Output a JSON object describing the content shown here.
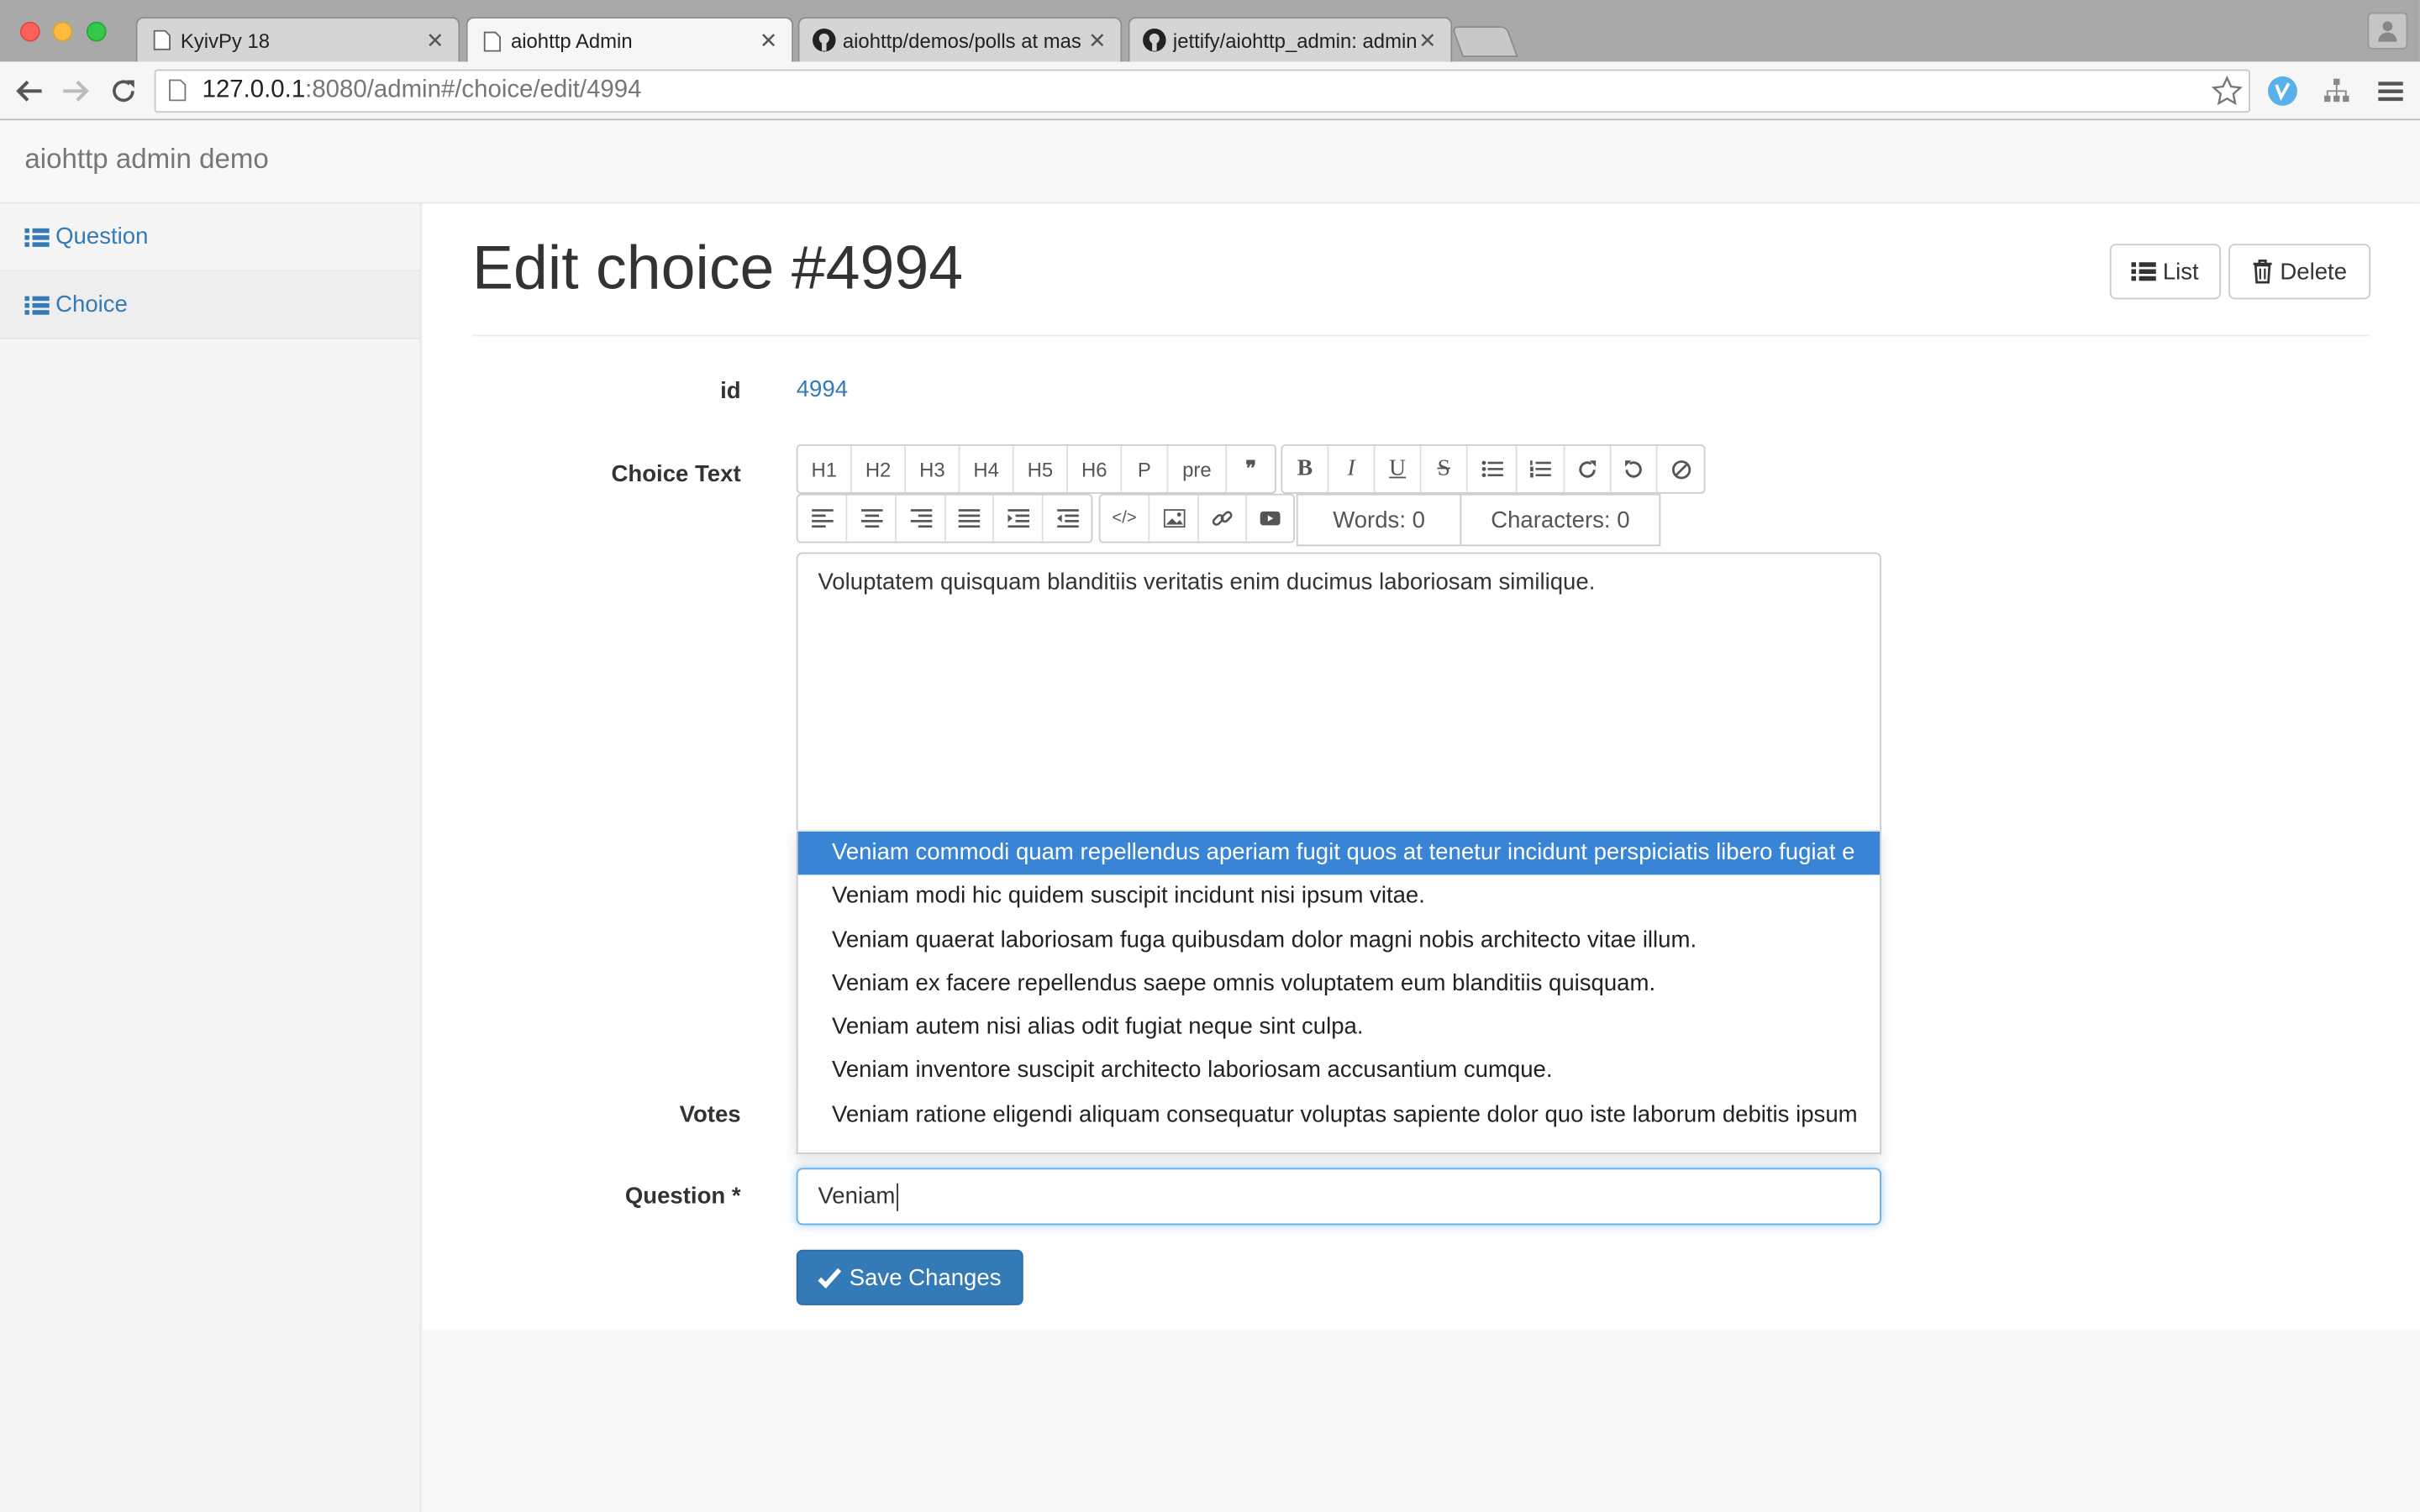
{
  "browser": {
    "tabs": [
      {
        "title": "KyivPy 18",
        "icon": "page-icon"
      },
      {
        "title": "aiohttp Admin",
        "icon": "page-icon"
      },
      {
        "title": "aiohttp/demos/polls at mas",
        "icon": "github-icon"
      },
      {
        "title": "jettify/aiohttp_admin: admin",
        "icon": "github-icon"
      }
    ],
    "url_host": "127.0.0.1",
    "url_path": ":8080/admin#/choice/edit/4994"
  },
  "app": {
    "brand": "aiohttp admin demo",
    "sidebar": [
      {
        "label": "Question"
      },
      {
        "label": "Choice"
      }
    ],
    "page_title": "Edit choice #4994",
    "buttons": {
      "list": "List",
      "delete": "Delete",
      "save": "Save Changes"
    },
    "fields": {
      "id_label": "id",
      "id_value": "4994",
      "choice_text_label": "Choice Text",
      "votes_label": "Votes",
      "question_label": "Question *"
    },
    "editor": {
      "toolbar_row1_group1": [
        "H1",
        "H2",
        "H3",
        "H4",
        "H5",
        "H6",
        "P",
        "pre",
        "❞"
      ],
      "words": "Words: 0",
      "characters": "Characters: 0",
      "content": "Voluptatem quisquam blanditiis veritatis enim ducimus laboriosam similique."
    },
    "question_value": "Veniam",
    "suggestions": [
      "Veniam commodi quam repellendus aperiam fugit quos at tenetur incidunt perspiciatis libero fugiat e",
      "Veniam modi hic quidem suscipit incidunt nisi ipsum vitae.",
      "Veniam quaerat laboriosam fuga quibusdam dolor magni nobis architecto vitae illum.",
      "Veniam ex facere repellendus saepe omnis voluptatem eum blanditiis quisquam.",
      "Veniam autem nisi alias odit fugiat neque sint culpa.",
      "Veniam inventore suscipit architecto laboriosam accusantium cumque.",
      "Veniam ratione eligendi aliquam consequatur voluptas sapiente dolor quo iste laborum debitis ipsum"
    ]
  }
}
